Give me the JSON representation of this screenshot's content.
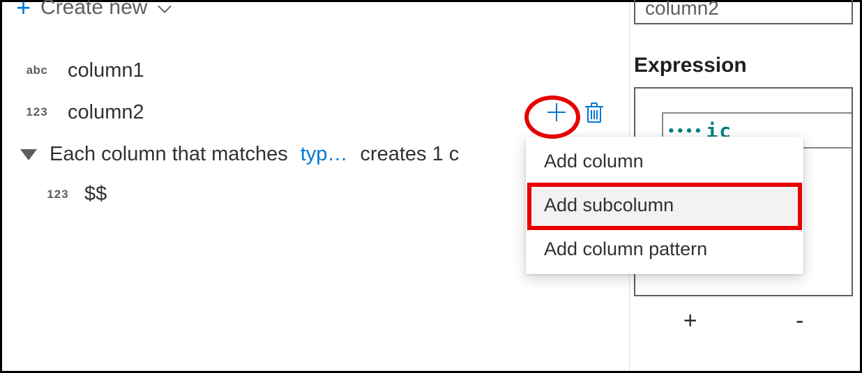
{
  "header": {
    "create_label": "Create new"
  },
  "columns": [
    {
      "type_label": "abc",
      "name": "column1"
    },
    {
      "type_label": "123",
      "name": "column2"
    }
  ],
  "pattern_row": {
    "prefix": "Each column that matches",
    "match_text": "typ…",
    "suffix": "creates 1 c"
  },
  "subcolumn": {
    "type_label": "123",
    "name": "$$"
  },
  "dropdown": {
    "items": [
      "Add column",
      "Add subcolumn",
      "Add column pattern"
    ]
  },
  "right": {
    "name_value": "column2",
    "section_title": "Expression",
    "expr_fragment": "ic",
    "plus_label": "+",
    "minus_label": "-"
  }
}
